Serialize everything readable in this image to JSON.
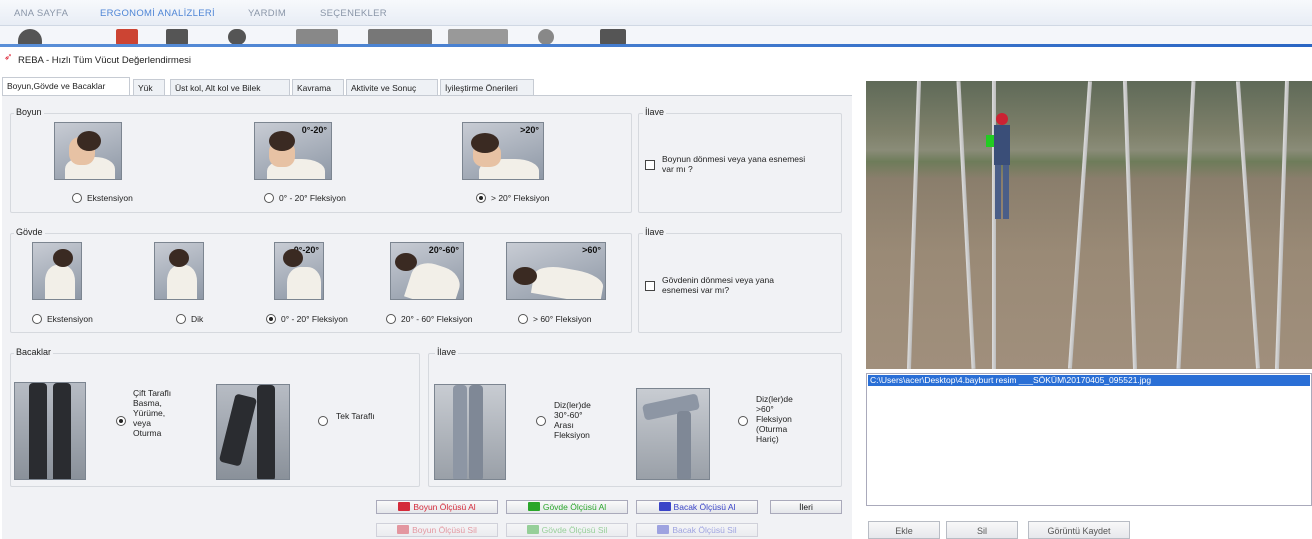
{
  "menu": {
    "tabs": [
      "ANA SAYFA",
      "ERGONOMİ ANALİZLERİ",
      "YARDIM",
      "SEÇENEKLER"
    ],
    "active_index": 1
  },
  "window": {
    "title": "REBA - Hızlı Tüm Vücut Değerlendirmesi"
  },
  "form_tabs": [
    "Boyun,Gövde ve Bacaklar",
    "Yük",
    "Üst kol, Alt kol ve Bilek",
    "Kavrama",
    "Aktivite ve Sonuç",
    "İyileştirme Önerileri"
  ],
  "neck": {
    "label": "Boyun",
    "options": [
      {
        "label": "Ekstensiyon",
        "angle": "",
        "selected": false
      },
      {
        "label": "0° - 20° Fleksiyon",
        "angle": "0°-20°",
        "selected": false
      },
      {
        "label": "> 20° Fleksiyon",
        "angle": ">20°",
        "selected": true
      }
    ],
    "extra": {
      "label": "İlave",
      "check_label": "Boynun dönmesi veya yana esnemesi var mı ?",
      "checked": false
    }
  },
  "trunk": {
    "label": "Gövde",
    "options": [
      {
        "label": "Ekstensiyon",
        "angle": "",
        "selected": false
      },
      {
        "label": "Dik",
        "angle": "",
        "selected": false
      },
      {
        "label": "0° - 20° Fleksiyon",
        "angle": "0°-20°",
        "selected": true
      },
      {
        "label": "20° - 60° Fleksiyon",
        "angle": "20°-60°",
        "selected": false
      },
      {
        "label": "> 60° Fleksiyon",
        "angle": ">60°",
        "selected": false
      }
    ],
    "extra": {
      "label": "İlave",
      "check_label": "Gövdenin dönmesi veya yana esnemesi var mı?",
      "checked": false
    }
  },
  "legs": {
    "label": "Bacaklar",
    "options": [
      {
        "label": "Çift Taraflı Basma, Yürüme, veya Oturma",
        "selected": true
      },
      {
        "label": "Tek Taraflı",
        "selected": false
      }
    ],
    "extra": {
      "label": "İlave",
      "options": [
        {
          "label": "Diz(ler)de 30°-60° Arası Fleksiyon",
          "selected": false
        },
        {
          "label": "Diz(ler)de >60° Fleksiyon (Oturma Hariç)",
          "selected": false
        }
      ]
    }
  },
  "actions": {
    "measure": [
      {
        "label": "Boyun Ölçüsü Al",
        "color": "#d42a3a"
      },
      {
        "label": "Gövde Ölçüsü Al",
        "color": "#2aa62a"
      },
      {
        "label": "Bacak Ölçüsü Al",
        "color": "#3a44c8"
      }
    ],
    "delete": [
      {
        "label": "Boyun Ölçüsü Sil",
        "color": "#d42a3a"
      },
      {
        "label": "Gövde Ölçüsü Sil",
        "color": "#2aa62a"
      },
      {
        "label": "Bacak Ölçüsü Sil",
        "color": "#3a44c8"
      }
    ],
    "next": "İleri"
  },
  "files": {
    "selected": "C:\\Users\\acer\\Desktop\\4.bayburt resim ___SÖKÜM\\20170405_095521.jpg"
  },
  "right_buttons": {
    "add": "Ekle",
    "delete": "Sil",
    "save": "Görüntü Kaydet"
  },
  "colors": {
    "accent": "#2a66c4",
    "selection": "#2a6fd6"
  }
}
